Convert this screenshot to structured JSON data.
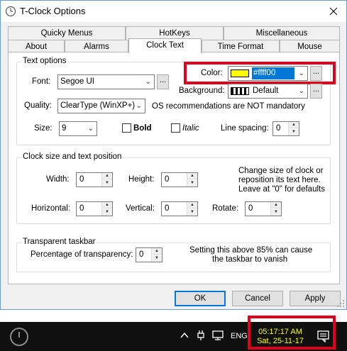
{
  "window": {
    "title": "T-Clock Options"
  },
  "tabs_row1": [
    "Quicky Menus",
    "HotKeys",
    "Miscellaneous"
  ],
  "tabs_row2": [
    "About",
    "Alarms",
    "Clock Text",
    "Time Format",
    "Mouse"
  ],
  "text_options": {
    "group_label": "Text options",
    "font_label": "Font:",
    "font_value": "Segoe UI",
    "color_label": "Color:",
    "color_value": "#ffff00",
    "color_swatch": "#ffff00",
    "background_label": "Background:",
    "background_value": "Default",
    "quality_label": "Quality:",
    "quality_value": "ClearType (WinXP+)",
    "quality_note": "OS recommendations are NOT mandatory",
    "size_label": "Size:",
    "size_value": "9",
    "bold_label": "Bold",
    "italic_label": "Italic",
    "line_spacing_label": "Line spacing:",
    "line_spacing_value": "0",
    "dots": "..."
  },
  "clock_size": {
    "group_label": "Clock size and text position",
    "width_label": "Width:",
    "width_value": "0",
    "height_label": "Height:",
    "height_value": "0",
    "info_line1": "Change size of clock or",
    "info_line2": "reposition its text here.",
    "info_line3": "Leave at \"0\" for defaults",
    "horizontal_label": "Horizontal:",
    "horizontal_value": "0",
    "vertical_label": "Vertical:",
    "vertical_value": "0",
    "rotate_label": "Rotate:",
    "rotate_value": "0"
  },
  "transparent": {
    "group_label": "Transparent taskbar",
    "percentage_label": "Percentage of transparency:",
    "percentage_value": "0",
    "note_line1": "Setting this above 85% can cause",
    "note_line2": "the taskbar to vanish"
  },
  "buttons": {
    "ok": "OK",
    "cancel": "Cancel",
    "apply": "Apply"
  },
  "taskbar": {
    "language": "ENG",
    "time": "05:17:17 AM",
    "date": "Sat, 25-11-17",
    "clock_color": "#ffff00"
  },
  "colors": {
    "highlight_red": "#e2001a",
    "accent_blue": "#0078d7"
  }
}
